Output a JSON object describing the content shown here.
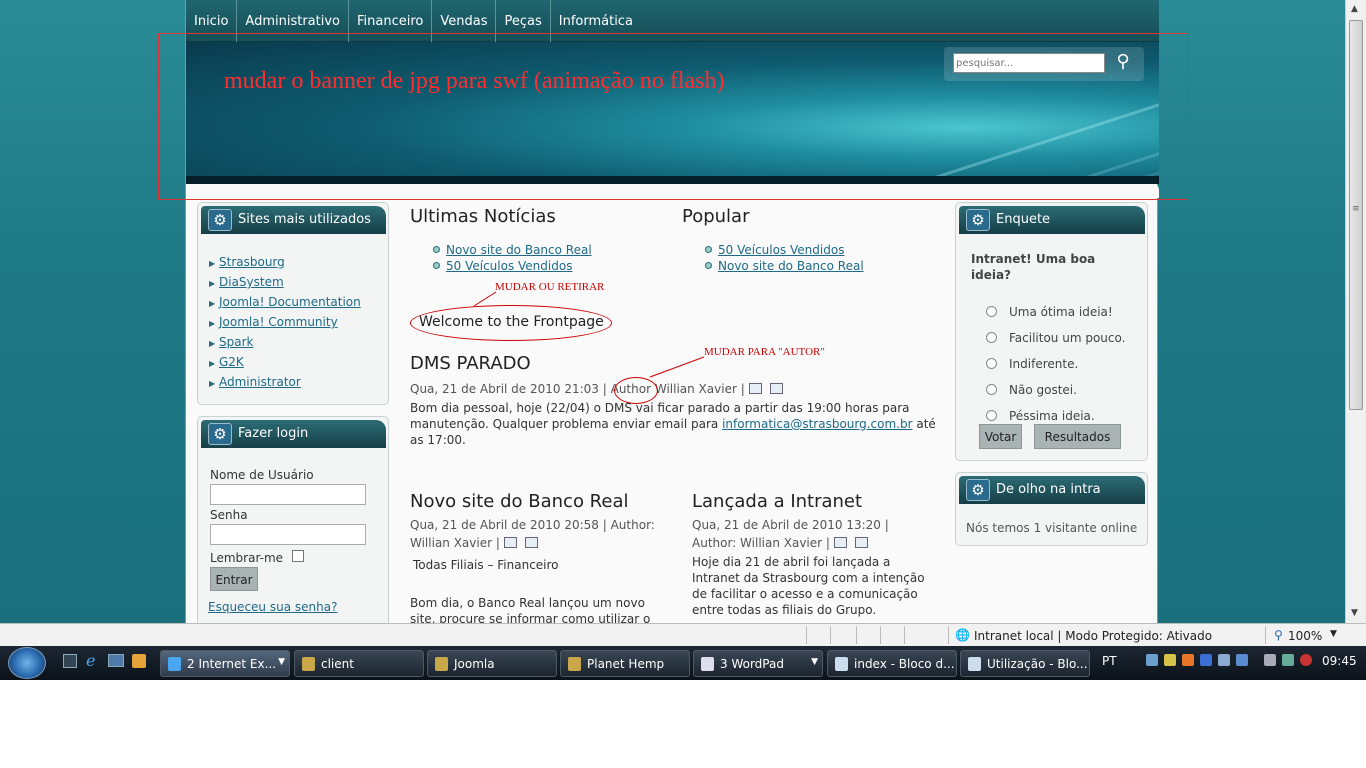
{
  "nav": [
    "Inicio",
    "Administrativo",
    "Financeiro",
    "Vendas",
    "Peças",
    "Informática"
  ],
  "search": {
    "placeholder": "pesquisar..."
  },
  "banner_note": "mudar o banner de jpg para swf (animação no flash)",
  "sites_module": {
    "title": "Sites mais utilizados",
    "items": [
      "Strasbourg",
      "DiaSystem",
      "Joomla! Documentation",
      "Joomla! Community",
      "Spark",
      "G2K",
      "Administrator"
    ]
  },
  "login_module": {
    "title": "Fazer login",
    "username_label": "Nome de Usuário",
    "password_label": "Senha",
    "remember_label": "Lembrar-me",
    "submit_label": "Entrar",
    "forgot_label": "Esqueceu sua senha?"
  },
  "latest": {
    "title": "Ultimas Notícias",
    "items": [
      "Novo site do Banco Real",
      "50 Veículos Vendidos"
    ]
  },
  "popular": {
    "title": "Popular",
    "items": [
      "50 Veículos Vendidos",
      "Novo site do Banco Real"
    ]
  },
  "annotations": {
    "retirar": "MUDAR OU RETIRAR",
    "autor": "MUDAR PARA \"AUTOR\""
  },
  "welcome": "Welcome to the Frontpage",
  "article1": {
    "title": "DMS PARADO",
    "date": "Qua, 21 de Abril de 2010 21:03 |",
    "author_label": "Author",
    "author": "Willian Xavier |",
    "body_1": "Bom dia pessoal, hoje (22/04) o DMS vai ficar parado a partir das 19:00 horas para manutenção. Qualquer problema enviar email para ",
    "email": "informatica@strasbourg.com.br",
    "body_2": " até as 17:00."
  },
  "article2": {
    "title": "Novo site do Banco Real",
    "meta_1": "Qua, 21 de Abril de 2010 20:58 | Author:",
    "meta_2": "Willian Xavier |",
    "subtitle": "Todas Filiais – Financeiro",
    "body": "Bom dia, o Banco Real lançou um novo site, procure se informar como utilizar o novo"
  },
  "article3": {
    "title": "Lançada a Intranet",
    "meta_1": "Qua, 21 de Abril de 2010 13:20 |",
    "meta_2": "Author: Willian Xavier |",
    "body": "Hoje dia 21 de abril foi lançada a Intranet da Strasbourg com a intenção de facilitar o acesso e a comunicação entre todas as filiais do Grupo."
  },
  "poll": {
    "title": "Enquete",
    "question": "Intranet! Uma boa ideia?",
    "options": [
      "Uma ótima ideia!",
      "Facilitou um pouco.",
      "Indiferente.",
      "Não gostei.",
      "Péssima ideia."
    ],
    "vote_label": "Votar",
    "results_label": "Resultados"
  },
  "online": {
    "title": "De olho na intra",
    "text": "Nós temos 1 visitante online"
  },
  "statusbar": {
    "zone": "Intranet local | Modo Protegido: Ativado",
    "zoom": "100%"
  },
  "taskbar": {
    "tasks": [
      "2 Internet Ex...",
      "client",
      "Joomla",
      "Planet Hemp",
      "3 WordPad",
      "index - Bloco d...",
      "Utilização - Blo..."
    ],
    "lang": "PT",
    "clock": "09:45"
  }
}
